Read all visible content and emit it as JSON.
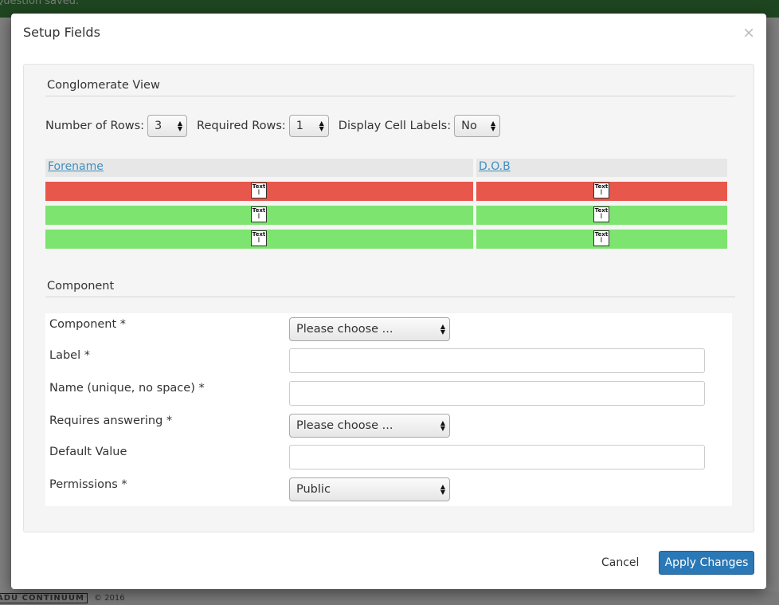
{
  "background": {
    "notification": "Question saved.",
    "footer_logo": "ADU CONTINUUM",
    "footer_copy": "© 2016"
  },
  "modal": {
    "title": "Setup Fields",
    "close_glyph": "×"
  },
  "conglomerate": {
    "heading": "Conglomerate View",
    "rows_label": "Number of Rows:",
    "rows_value": "3",
    "required_label": "Required Rows:",
    "required_value": "1",
    "cell_labels_label": "Display Cell Labels:",
    "cell_labels_value": "No",
    "columns": [
      "Forename",
      "D.O.B"
    ],
    "row_states": [
      "required",
      "optional",
      "optional"
    ],
    "edit_icon_text": "Text"
  },
  "component": {
    "heading": "Component",
    "fields": {
      "component_label": "Component *",
      "component_value": "Please choose ...",
      "label_label": "Label *",
      "label_value": "",
      "name_label": "Name (unique, no space) *",
      "name_value": "",
      "requires_label": "Requires answering *",
      "requires_value": "Please choose ...",
      "default_label": "Default Value",
      "default_value": "",
      "permissions_label": "Permissions *",
      "permissions_value": "Public"
    }
  },
  "footer": {
    "cancel_label": "Cancel",
    "apply_label": "Apply Changes"
  },
  "colors": {
    "required_row": "#e8574b",
    "optional_row": "#7de46f",
    "primary_button": "#2a78b6",
    "link": "#3f8fc0"
  }
}
